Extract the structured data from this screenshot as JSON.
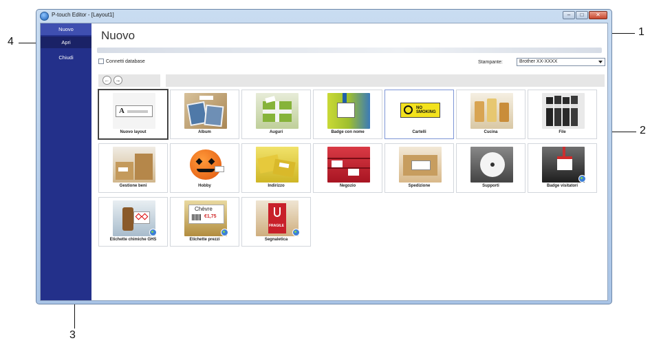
{
  "window": {
    "title": "P-touch Editor - [Layout1]",
    "controls": [
      "–",
      "□",
      "✕"
    ]
  },
  "sidebar": {
    "items": [
      {
        "label": "Nuovo"
      },
      {
        "label": "Apri"
      },
      {
        "label": "Chiudi"
      }
    ]
  },
  "main": {
    "heading": "Nuovo",
    "db_checkbox_label": "Connetti database",
    "db_checked": false,
    "printer_label": "Stampante:",
    "printer_value": "Brother XX-XXXX"
  },
  "tiles": [
    {
      "label": "Nuovo layout"
    },
    {
      "label": "Album"
    },
    {
      "label": "Auguri"
    },
    {
      "label": "Badge con nome"
    },
    {
      "label": "Cartelli"
    },
    {
      "label": "Cucina"
    },
    {
      "label": "File"
    },
    {
      "label": "Gestione beni"
    },
    {
      "label": "Hobby"
    },
    {
      "label": "Indirizzo"
    },
    {
      "label": "Negozio"
    },
    {
      "label": "Spedizione"
    },
    {
      "label": "Supporti"
    },
    {
      "label": "Badge visitatori"
    },
    {
      "label": "Etichette chimiche GHS"
    },
    {
      "label": "Etichette prezzi"
    },
    {
      "label": "Segnaletica"
    }
  ],
  "thumb_texts": {
    "no_smoking": "NO SMOKING",
    "chevre": "Chèvre",
    "price": "€1,75",
    "fragile": "FRAGILE"
  },
  "callouts": {
    "c1": "1",
    "c2": "2",
    "c3": "3",
    "c4": "4"
  }
}
